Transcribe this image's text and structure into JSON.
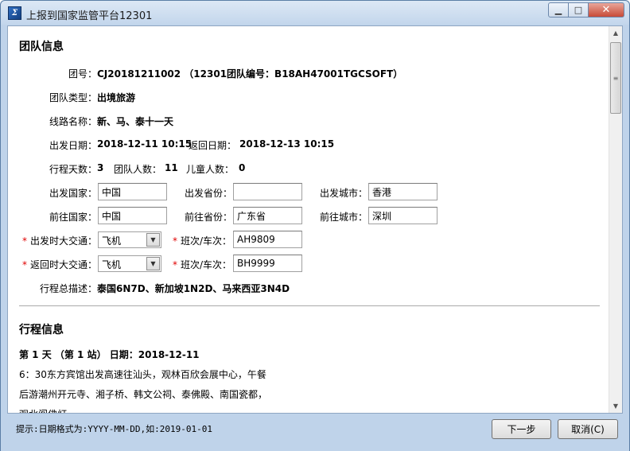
{
  "window": {
    "title": "上报到国家监管平台12301",
    "icon": "app-logo-icon",
    "controls": {
      "minimize": "▁",
      "maximize": "□",
      "close": "✕"
    }
  },
  "team_info": {
    "heading": "团队信息",
    "group_no_label": "团号：",
    "group_no_value": "CJ20181211002 （12301团队编号：B18AH47001TGCSOFT）",
    "group_type_label": "团队类型：",
    "group_type_value": "出境旅游",
    "route_name_label": "线路名称：",
    "route_name_value": "新、马、泰十一天",
    "depart_date_label": "出发日期：",
    "depart_date_value": "2018-12-11 10:15",
    "return_date_label": "返回日期：",
    "return_date_value": "2018-12-13 10:15",
    "days_label": "行程天数：",
    "days_value": "3",
    "people_label": "团队人数：",
    "people_value": "11",
    "children_label": "儿童人数：",
    "children_value": "0",
    "depart_country_label": "出发国家：",
    "depart_country_value": "中国",
    "depart_province_label": "出发省份：",
    "depart_province_value": "",
    "depart_city_label": "出发城市：",
    "depart_city_value": "香港",
    "dest_country_label": "前往国家：",
    "dest_country_value": "中国",
    "dest_province_label": "前往省份：",
    "dest_province_value": "广东省",
    "dest_city_label": "前往城市：",
    "dest_city_value": "深圳",
    "required_mark": "*",
    "depart_transport_label": "出发时大交通：",
    "depart_transport_value": "飞机",
    "depart_flight_label": "班次/车次：",
    "depart_flight_value": "AH9809",
    "return_transport_label": "返回时大交通：",
    "return_transport_value": "飞机",
    "return_flight_label": "班次/车次：",
    "return_flight_value": "BH9999",
    "itinerary_desc_label": "行程总描述：",
    "itinerary_desc_value": "泰国6N7D、新加坡1N2D、马来西亚3N4D"
  },
  "trip_info": {
    "heading": "行程信息",
    "day_title": "第 1 天 （第 1 站） 日期：2018-12-11",
    "lines": [
      "6：30东方宾馆出发高速往汕头，观林百欣会展中心，午餐",
      "后游潮州开元寺、湘子桥、韩文公祠、泰佛殿、南国瓷都，",
      "观北阁佛灯"
    ]
  },
  "status": {
    "hint": "提示:日期格式为:YYYY-MM-DD,如:2019-01-01",
    "next_label": "下一步",
    "cancel_label": "取消(C)"
  }
}
